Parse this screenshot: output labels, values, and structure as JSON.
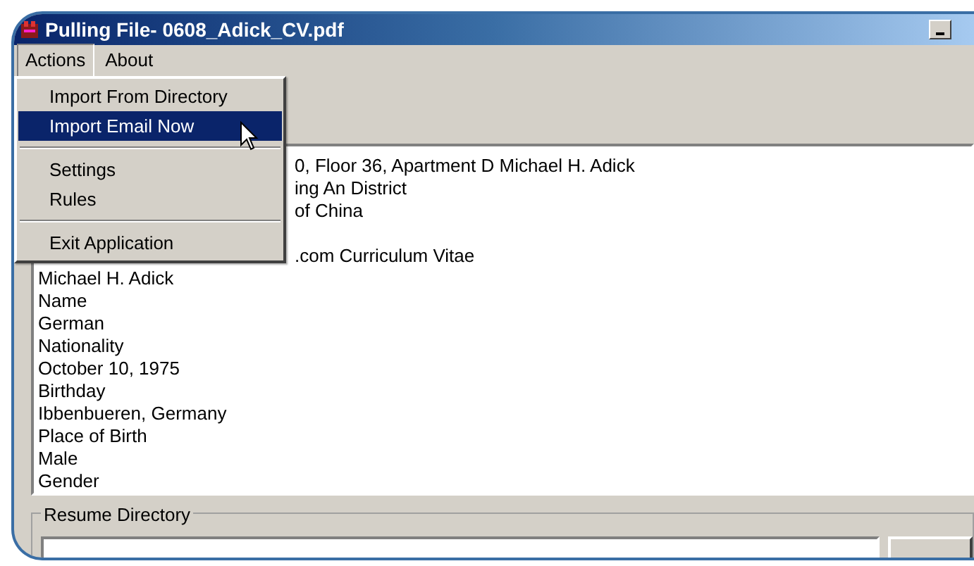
{
  "window": {
    "title": "Pulling File- 0608_Adick_CV.pdf"
  },
  "menu_bar": [
    {
      "label": "Actions",
      "selected": true
    },
    {
      "label": "About",
      "selected": false
    }
  ],
  "dropdown": [
    {
      "kind": "item",
      "label": "Import From Directory",
      "selected": false
    },
    {
      "kind": "item",
      "label": "Import Email Now",
      "selected": true
    },
    {
      "kind": "separator"
    },
    {
      "kind": "item",
      "label": "Settings",
      "selected": false
    },
    {
      "kind": "item",
      "label": "Rules",
      "selected": false
    },
    {
      "kind": "separator"
    },
    {
      "kind": "item",
      "label": "Exit Application",
      "selected": false
    }
  ],
  "document_lines": [
    {
      "kind": "partial",
      "text": "0, Floor 36, Apartment D Michael H. Adick"
    },
    {
      "kind": "partial",
      "text": "ing An District"
    },
    {
      "kind": "partial",
      "text": "of China"
    },
    {
      "kind": "gap"
    },
    {
      "kind": "partial",
      "text": ".com Curriculum Vitae"
    },
    {
      "kind": "text",
      "text": "Michael H. Adick"
    },
    {
      "kind": "text",
      "text": "Name"
    },
    {
      "kind": "text",
      "text": "German"
    },
    {
      "kind": "text",
      "text": "Nationality"
    },
    {
      "kind": "text",
      "text": "October 10, 1975"
    },
    {
      "kind": "text",
      "text": "Birthday"
    },
    {
      "kind": "text",
      "text": "Ibbenbueren, Germany"
    },
    {
      "kind": "text",
      "text": "Place of Birth"
    },
    {
      "kind": "text",
      "text": "Male"
    },
    {
      "kind": "text",
      "text": "Gender"
    }
  ],
  "resume_directory": {
    "label": "Resume Directory"
  }
}
